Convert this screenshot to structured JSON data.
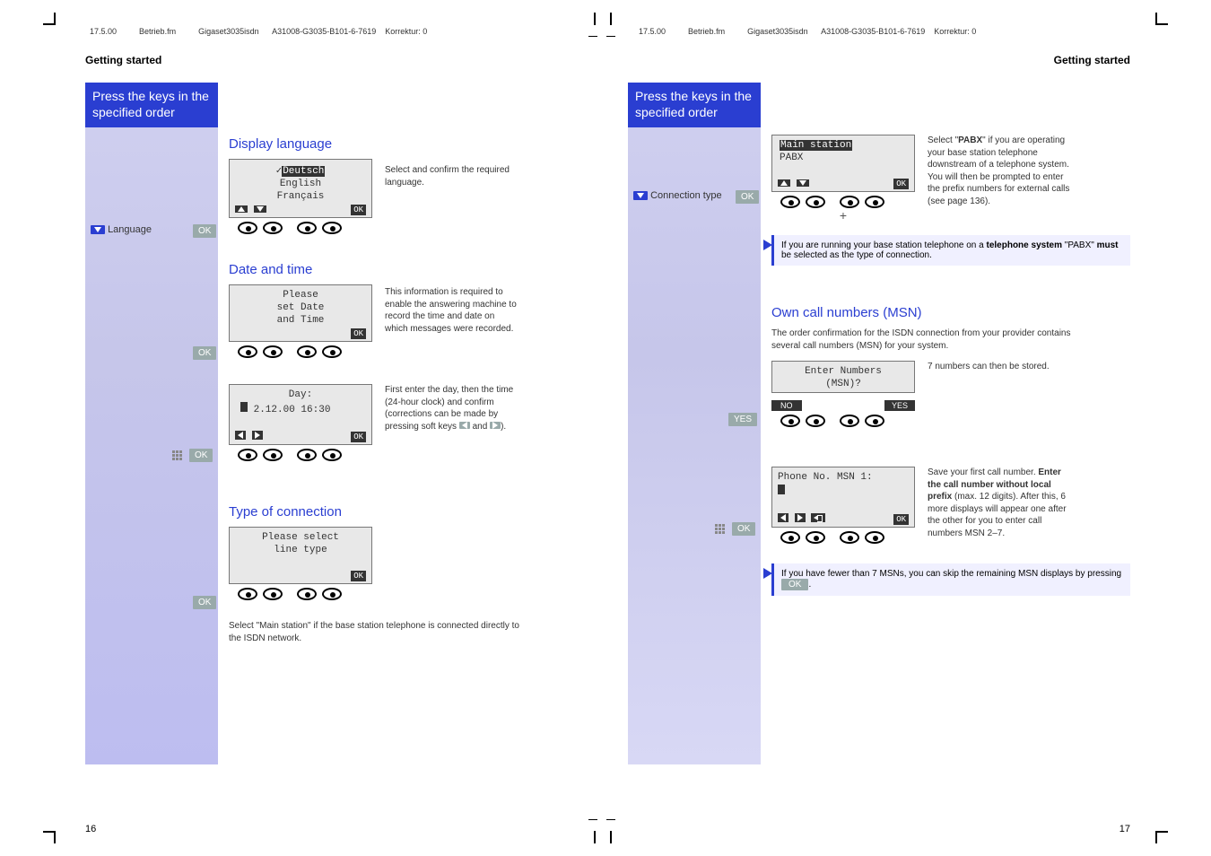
{
  "meta_left": {
    "date": "17.5.00",
    "file": "Betrieb.fm",
    "model": "Gigaset3035isdn",
    "code": "A31008-G3035-B101-6-7619",
    "korr": "Korrektur: 0"
  },
  "meta_right": {
    "date": "17.5.00",
    "file": "Betrieb.fm",
    "model": "Gigaset3035isdn",
    "code": "A31008-G3035-B101-6-7619",
    "korr": "Korrektur: 0"
  },
  "left": {
    "heading": "Getting started",
    "banner1": "Press the keys in the",
    "banner2": "specified order",
    "step_lang": "Language",
    "ok": "OK",
    "sec_lang": "Display language",
    "lcd_lang": {
      "l1": "Deutsch",
      "l2": "English",
      "l3": "Français",
      "ok": "OK"
    },
    "desc_lang": "Select and confirm the required language.",
    "sec_date": "Date and time",
    "lcd_date": {
      "l1": "Please",
      "l2": "set Date",
      "l3": "and Time",
      "ok": "OK"
    },
    "desc_date": "This information is required to enable the answering machine to record the time and date on which messages were recorded.",
    "lcd_day": {
      "l1": "Day:",
      "l2": "2.12.00 16:30",
      "ok": "OK"
    },
    "desc_day1": "First enter the day, then the time (24-hour clock) and confirm (corrections can be made by pressing soft keys",
    "desc_day2": "and",
    "desc_day3": ").",
    "sec_conn": "Type of connection",
    "lcd_conn": {
      "l1": "Please select",
      "l2": "line type",
      "ok": "OK"
    },
    "footnote": "Select \"Main station\" if the base station telephone is connected directly to the ISDN network.",
    "pagenum": "16"
  },
  "right": {
    "heading": "Getting started",
    "banner1": "Press the keys in the",
    "banner2": "specified order",
    "step_conn": "Connection type",
    "ok": "OK",
    "yes": "YES",
    "lcd_main": {
      "l1": "Main station",
      "l2": "PABX",
      "ok": "OK"
    },
    "desc_main1": "Select \"",
    "desc_main_b": "PABX",
    "desc_main2": "\" if you are operating your base station telephone downstream of a telephone system. You will then be prompted to enter the prefix numbers for external calls (see page 136).",
    "note1a": "If you are running your base station telephone on a ",
    "note1b": "telephone system",
    "note1c": " \"PABX\" ",
    "note1d": "must",
    "note1e": " be selected as the type of connection.",
    "sec_msn": "Own call numbers (MSN)",
    "desc_msn_intro": "The order confirmation for the ISDN connection from your provider contains several call numbers (MSN) for your system.",
    "lcd_enter": {
      "l1": "Enter Numbers",
      "l2": "(MSN)?",
      "no": "NO",
      "yes": "YES"
    },
    "desc_enter": "7 numbers can then be stored.",
    "lcd_phone": {
      "l1": "Phone No. MSN 1:",
      "ok": "OK"
    },
    "desc_phone1": "Save your first call number. ",
    "desc_phone_b1": "Enter the call number without local prefix",
    "desc_phone2": " (max. 12 digits). After this, 6 more displays will appear one after the other for you to enter call numbers MSN 2–7.",
    "note2a": "If you have fewer than 7 MSNs, you can skip the remaining MSN displays by pressing ",
    "note2_ok": "OK",
    "note2b": ".",
    "pagenum": "17"
  }
}
